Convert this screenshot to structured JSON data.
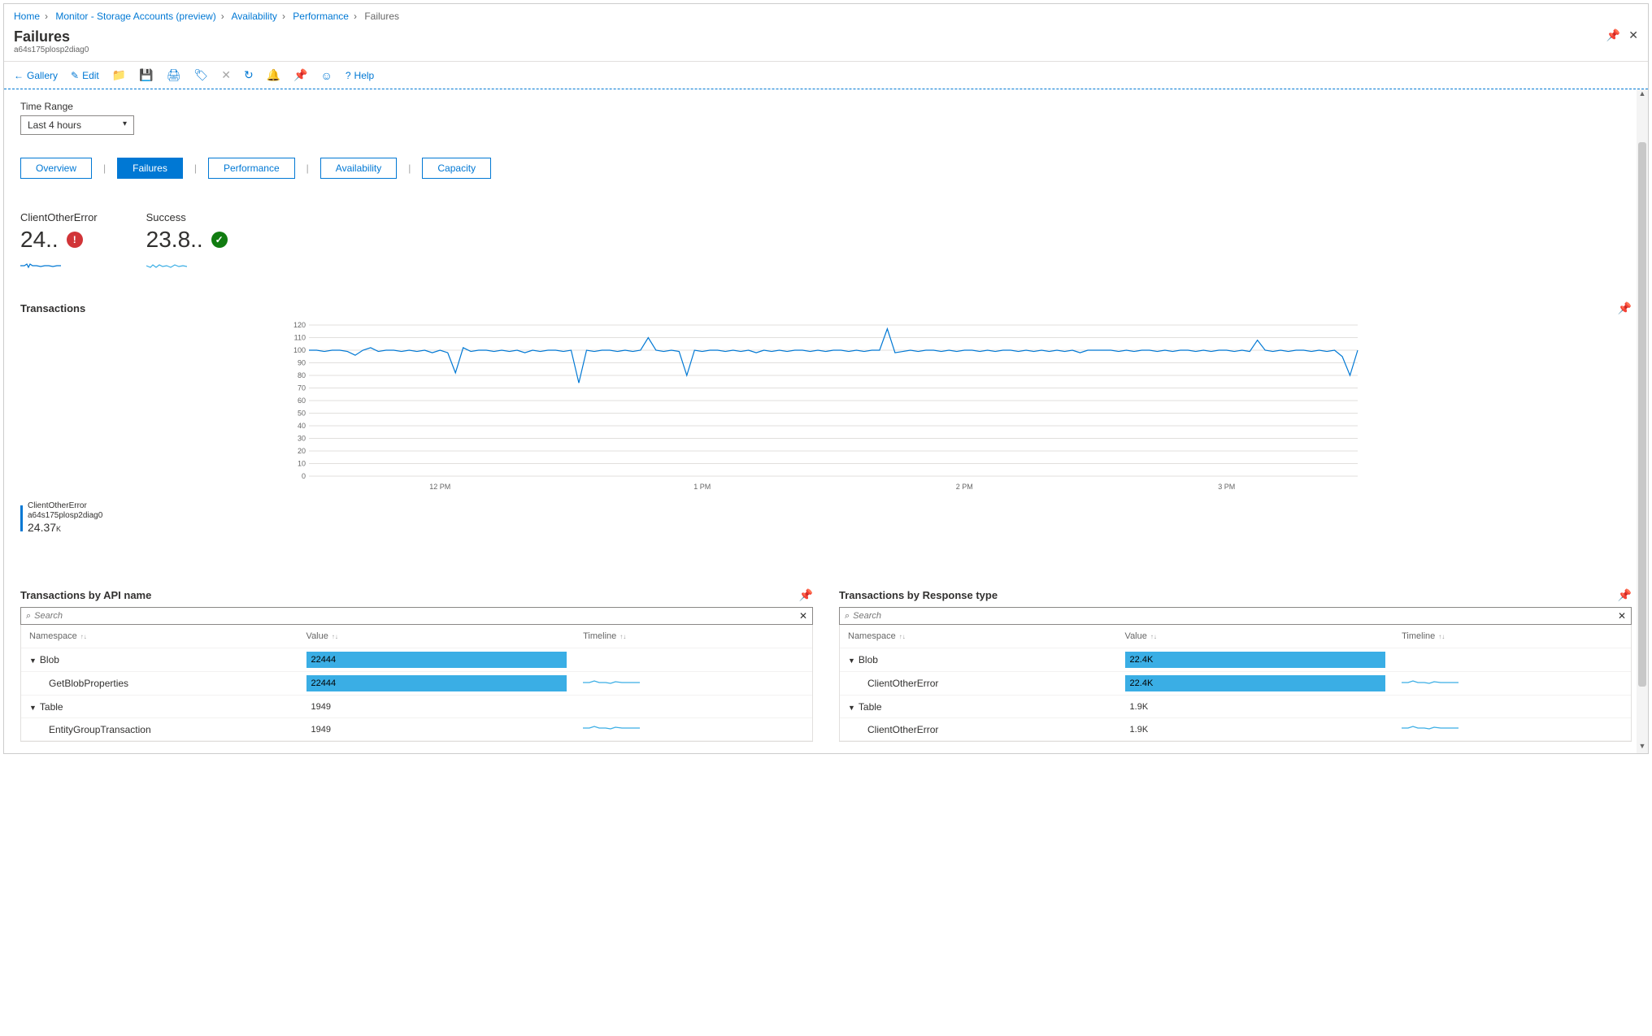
{
  "breadcrumb": {
    "items": [
      "Home",
      "Monitor - Storage Accounts (preview)",
      "Availability",
      "Performance"
    ],
    "current": "Failures"
  },
  "header": {
    "title": "Failures",
    "subtitle": "a64s175plosp2diag0"
  },
  "header_actions": {
    "pin_title": "Pin",
    "close_title": "Close"
  },
  "toolbar": {
    "gallery": "Gallery",
    "edit": "Edit",
    "help": "Help"
  },
  "filters": {
    "time_range_label": "Time Range",
    "time_range_value": "Last 4 hours"
  },
  "tabs": [
    "Overview",
    "Failures",
    "Performance",
    "Availability",
    "Capacity"
  ],
  "active_tab": 1,
  "stats": [
    {
      "label": "ClientOtherError",
      "value": "24..",
      "badge": "red",
      "badge_glyph": "!",
      "spark_color": "#0078d4"
    },
    {
      "label": "Success",
      "value": "23.8..",
      "badge": "green",
      "badge_glyph": "✓",
      "spark_color": "#3aaee5"
    }
  ],
  "transactions_section": {
    "title": "Transactions",
    "legend_name": "ClientOtherError",
    "legend_sub": "a64s175plosp2diag0",
    "legend_value": "24.37",
    "legend_unit": "K"
  },
  "chart_data": {
    "type": "line",
    "title": "Transactions",
    "xlabel": "",
    "ylabel": "",
    "ylim": [
      0,
      120
    ],
    "yticks": [
      0,
      10,
      20,
      30,
      40,
      50,
      60,
      70,
      80,
      90,
      100,
      110,
      120
    ],
    "x_tick_labels": [
      "12 PM",
      "1 PM",
      "2 PM",
      "3 PM"
    ],
    "series": [
      {
        "name": "ClientOtherError",
        "account": "a64s175plosp2diag0",
        "total": "24.37K",
        "color": "#0078d4",
        "values": [
          100,
          100,
          99,
          100,
          100,
          99,
          96,
          100,
          102,
          99,
          100,
          100,
          99,
          100,
          99,
          100,
          98,
          100,
          98,
          82,
          102,
          99,
          100,
          100,
          99,
          100,
          99,
          100,
          98,
          100,
          99,
          100,
          100,
          99,
          100,
          74,
          100,
          99,
          100,
          100,
          99,
          100,
          99,
          100,
          110,
          100,
          99,
          100,
          99,
          80,
          100,
          99,
          100,
          100,
          99,
          100,
          99,
          100,
          98,
          100,
          99,
          100,
          99,
          100,
          100,
          99,
          100,
          99,
          100,
          100,
          99,
          100,
          99,
          100,
          100,
          117,
          98,
          99,
          100,
          99,
          100,
          100,
          99,
          100,
          99,
          100,
          100,
          99,
          100,
          99,
          100,
          100,
          99,
          100,
          99,
          100,
          99,
          100,
          99,
          100,
          98,
          100,
          100,
          100,
          100,
          99,
          100,
          99,
          100,
          100,
          99,
          100,
          99,
          100,
          100,
          99,
          100,
          99,
          100,
          100,
          99,
          100,
          99,
          108,
          100,
          99,
          100,
          99,
          100,
          100,
          99,
          100,
          99,
          100,
          95,
          80,
          100
        ]
      }
    ]
  },
  "panel_api": {
    "title": "Transactions by API name",
    "search_placeholder": "Search",
    "columns": [
      "Namespace",
      "Value",
      "Timeline"
    ],
    "rows": [
      {
        "ns": "Blob",
        "indent": false,
        "value": "22444",
        "bar_pct": 100,
        "has_timeline": false
      },
      {
        "ns": "GetBlobProperties",
        "indent": true,
        "value": "22444",
        "bar_pct": 100,
        "has_timeline": true
      },
      {
        "ns": "Table",
        "indent": false,
        "value": "1949",
        "bar_pct": 0,
        "has_timeline": false
      },
      {
        "ns": "EntityGroupTransaction",
        "indent": true,
        "value": "1949",
        "bar_pct": 0,
        "has_timeline": true
      }
    ]
  },
  "panel_resp": {
    "title": "Transactions by Response type",
    "search_placeholder": "Search",
    "columns": [
      "Namespace",
      "Value",
      "Timeline"
    ],
    "rows": [
      {
        "ns": "Blob",
        "indent": false,
        "value": "22.4K",
        "bar_pct": 100,
        "has_timeline": false
      },
      {
        "ns": "ClientOtherError",
        "indent": true,
        "value": "22.4K",
        "bar_pct": 100,
        "has_timeline": true
      },
      {
        "ns": "Table",
        "indent": false,
        "value": "1.9K",
        "bar_pct": 0,
        "has_timeline": false
      },
      {
        "ns": "ClientOtherError",
        "indent": true,
        "value": "1.9K",
        "bar_pct": 0,
        "has_timeline": true
      }
    ]
  }
}
